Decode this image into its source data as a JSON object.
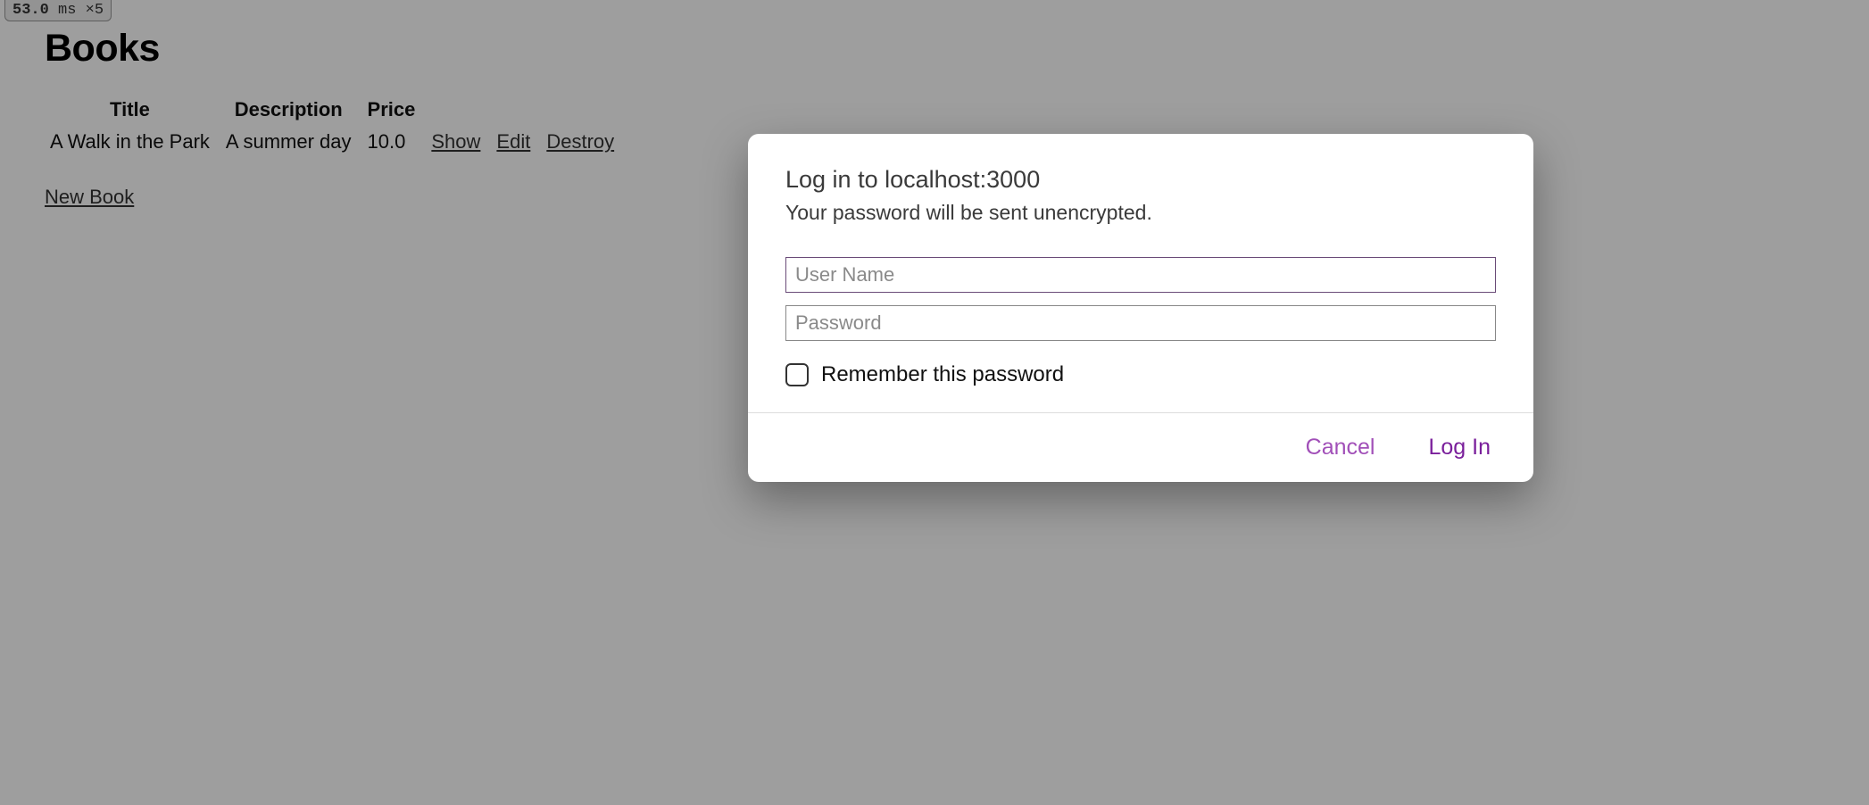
{
  "timing": {
    "value": "53.0",
    "unit": "ms",
    "multiplier": "×5"
  },
  "page": {
    "title": "Books",
    "headers": {
      "title": "Title",
      "description": "Description",
      "price": "Price"
    },
    "rows": [
      {
        "title": "A Walk in the Park",
        "description": "A summer day",
        "price": "10.0",
        "show": "Show",
        "edit": "Edit",
        "destroy": "Destroy"
      }
    ],
    "new_book": "New Book"
  },
  "dialog": {
    "title": "Log in to localhost:3000",
    "subtitle": "Your password will be sent unencrypted.",
    "username_placeholder": "User Name",
    "password_placeholder": "Password",
    "remember_label": "Remember this password",
    "cancel": "Cancel",
    "login": "Log In"
  }
}
